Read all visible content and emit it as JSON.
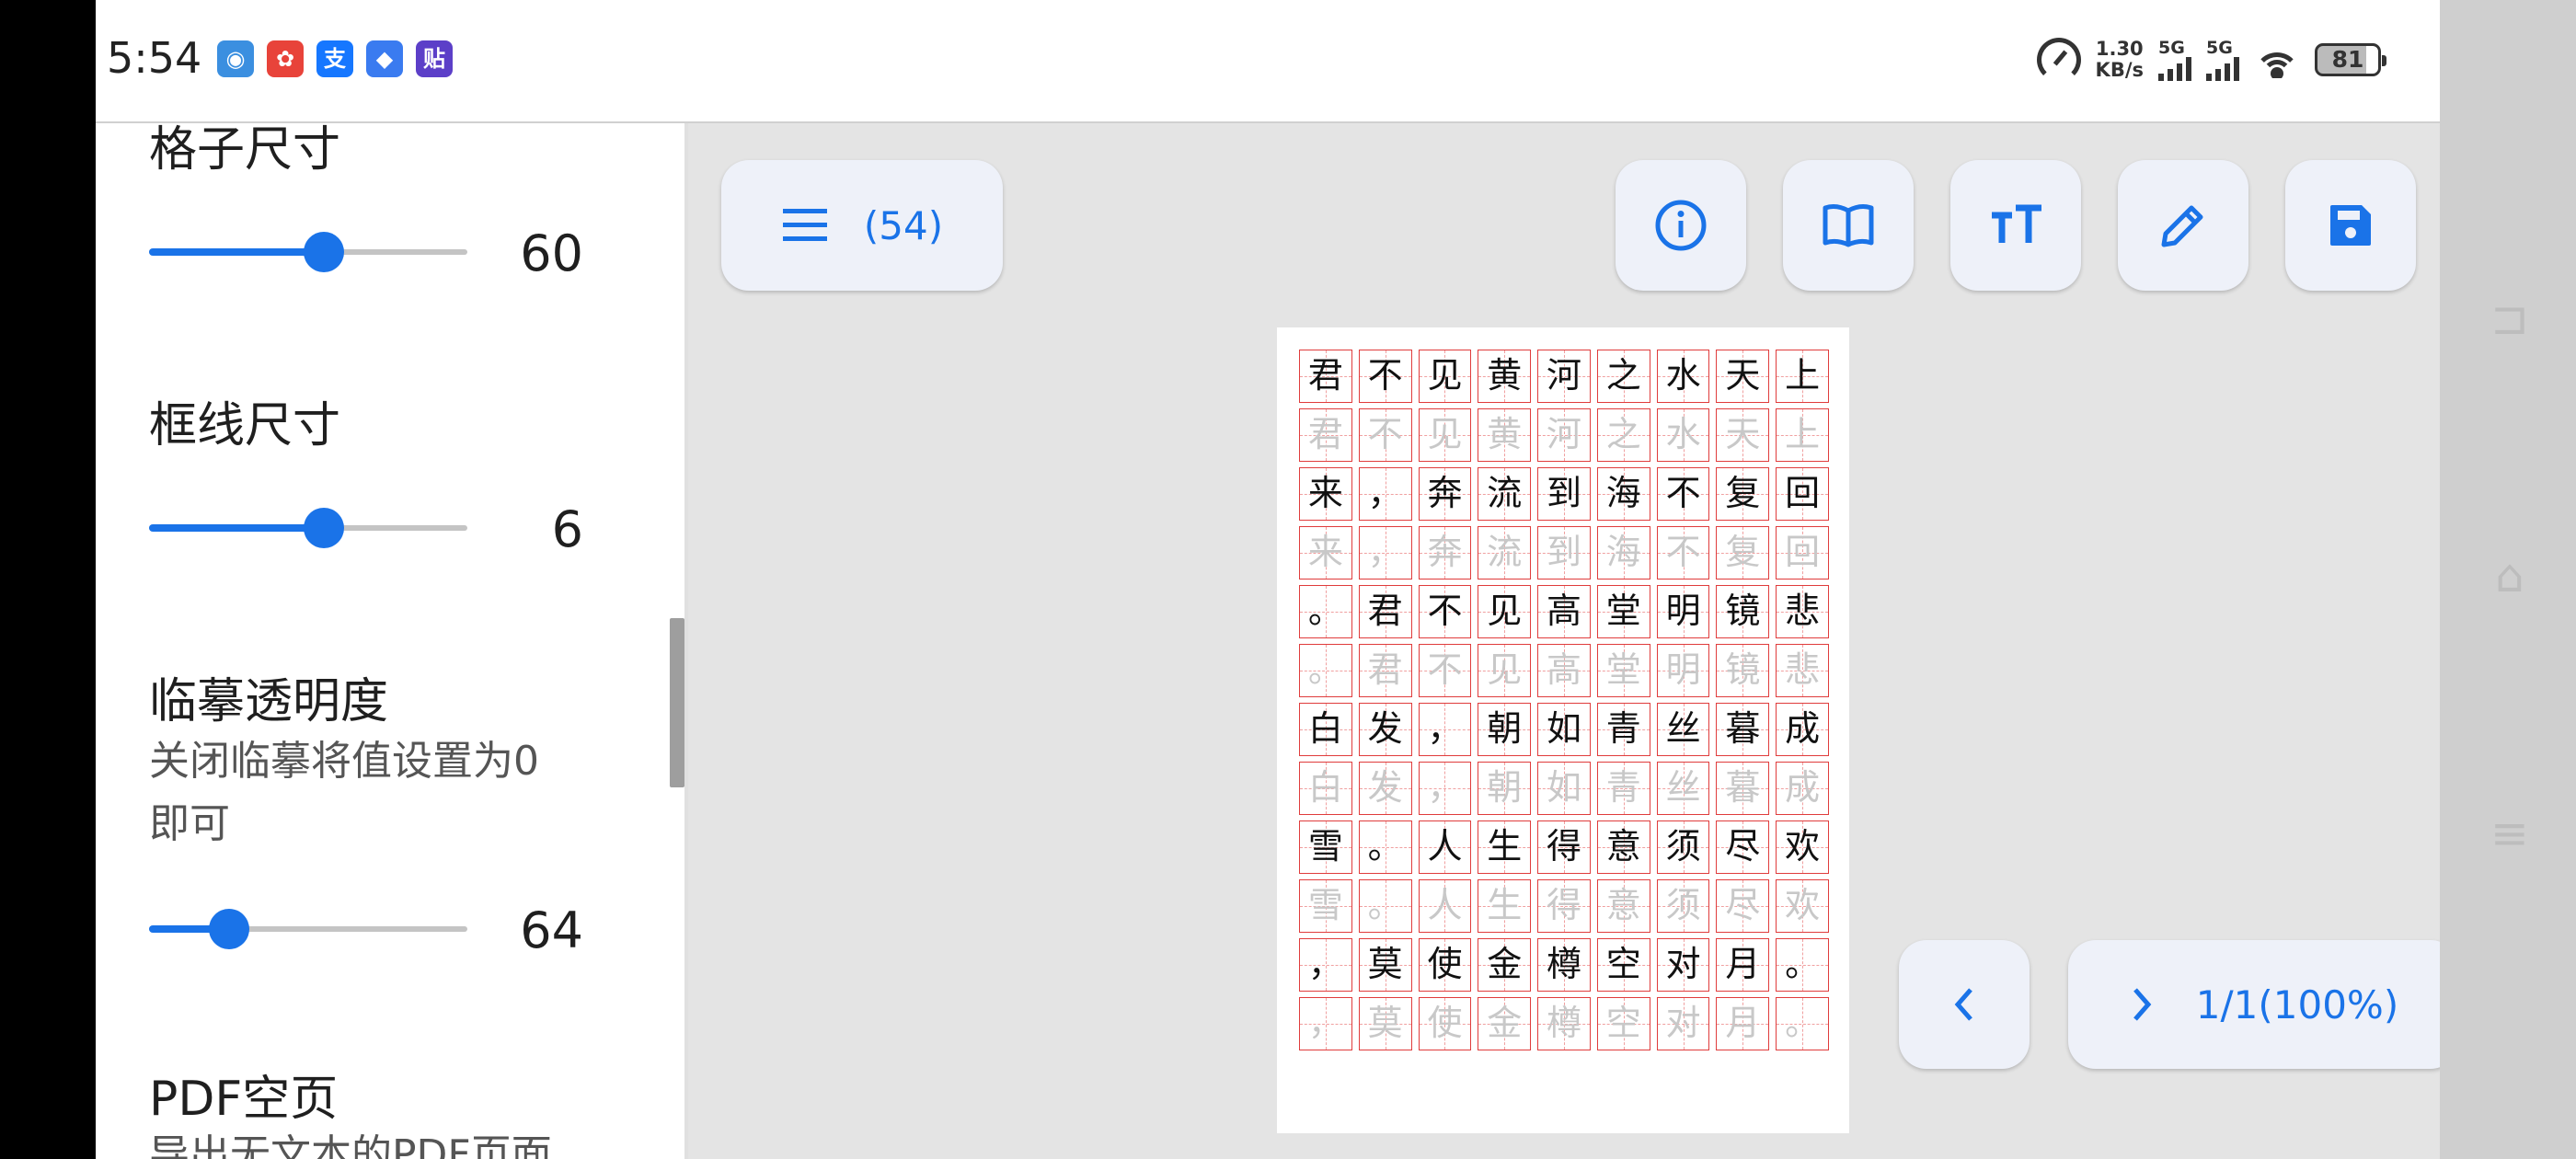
{
  "status_bar": {
    "time": "5:54",
    "notifications": [
      {
        "name": "app-notification-icon",
        "glyph": "◉",
        "color": "#3b8fe0"
      },
      {
        "name": "game-notification-icon",
        "glyph": "✿",
        "color": "#e8433a"
      },
      {
        "name": "alipay-notification-icon",
        "glyph": "支",
        "color": "#1677ff"
      },
      {
        "name": "app2-notification-icon",
        "glyph": "◆",
        "color": "#3a7bf0"
      },
      {
        "name": "tieba-notification-icon",
        "glyph": "贴",
        "color": "#5c3fc8"
      }
    ],
    "net_speed": "1.30",
    "net_unit": "KB/s",
    "sim1": "5G",
    "sim2": "5G",
    "battery": "81"
  },
  "settings": {
    "grid_size": {
      "title": "格子尺寸",
      "value": "60",
      "fraction": 0.55
    },
    "line_size": {
      "title": "框线尺寸",
      "value": "6",
      "fraction": 0.55
    },
    "opacity": {
      "title": "临摹透明度",
      "subtitle_1": "关闭临摹将值设置为0",
      "subtitle_2": "即可",
      "value": "64",
      "fraction": 0.25
    },
    "pdf_blank": {
      "title": "PDF空页",
      "subtitle": "导出无文本的PDF页面"
    }
  },
  "toolbar": {
    "menu_count": "(54)",
    "buttons": [
      "info-icon",
      "book-icon",
      "text-size-icon",
      "edit-icon",
      "save-icon"
    ]
  },
  "worksheet": {
    "rows": [
      [
        "君",
        "不",
        "见",
        "黄",
        "河",
        "之",
        "水",
        "天",
        "上"
      ],
      [
        "来",
        "，",
        "奔",
        "流",
        "到",
        "海",
        "不",
        "复",
        "回"
      ],
      [
        "。",
        "君",
        "不",
        "见",
        "高",
        "堂",
        "明",
        "镜",
        "悲"
      ],
      [
        "白",
        "发",
        "，",
        "朝",
        "如",
        "青",
        "丝",
        "暮",
        "成"
      ],
      [
        "雪",
        "。",
        "人",
        "生",
        "得",
        "意",
        "须",
        "尽",
        "欢"
      ],
      [
        "，",
        "莫",
        "使",
        "金",
        "樽",
        "空",
        "对",
        "月",
        "。"
      ]
    ]
  },
  "pager": {
    "prev_icon": "chevron-left-icon",
    "next_icon": "chevron-right-icon",
    "page_info": "1/1(100%)"
  },
  "colors": {
    "accent": "#1a73e8",
    "grid_line": "#e03c3c",
    "trace_text": "#c8c8c8"
  }
}
